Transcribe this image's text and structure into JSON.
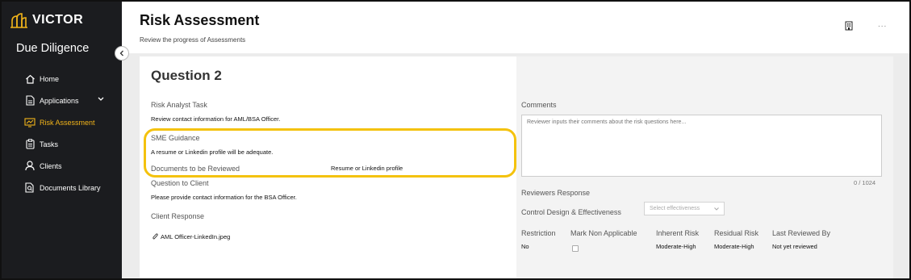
{
  "brand": {
    "name": "VICTOR",
    "accent": "#f2b41a"
  },
  "sidebar": {
    "app_title": "Due Diligence",
    "items": [
      {
        "label": "Home",
        "icon": "home-icon"
      },
      {
        "label": "Applications",
        "icon": "document-icon"
      },
      {
        "label": "Risk Assessment",
        "icon": "monitor-chart-icon",
        "active": true
      },
      {
        "label": "Tasks",
        "icon": "clipboard-icon"
      },
      {
        "label": "Clients",
        "icon": "user-icon"
      },
      {
        "label": "Documents Library",
        "icon": "document-search-icon"
      }
    ]
  },
  "header": {
    "title": "Risk Assessment",
    "subtitle": "Review the progress of Assessments",
    "more": "..."
  },
  "question": {
    "title": "Question 2",
    "risk_task_label": "Risk Analyst Task",
    "risk_task_text": "Review contact information for AML/BSA Officer.",
    "sme_label": "SME Guidance",
    "sme_text": "A resume or Linkedin profile will be adequate.",
    "docs_label": "Documents to be Reviewed",
    "docs_value": "Resume or Linkedin profile",
    "client_q_label": "Question to Client",
    "client_q_text": "Please provide contact information for the BSA Officer.",
    "client_resp_label": "Client Response",
    "attachment": "AML Officer-LinkedIn.jpeg"
  },
  "review": {
    "comments_label": "Comments",
    "comments_placeholder": "Reviewer inputs their comments about the risk questions here...",
    "char_count": "0 / 1024",
    "reviewers_response_label": "Reviewers Response",
    "control_label": "Control Design & Effectiveness",
    "select_placeholder": "Select effectiveness",
    "restriction_label": "Restriction",
    "restriction_value": "No",
    "mark_na_label": "Mark Non Applicable",
    "inherent_label": "Inherent Risk",
    "inherent_value": "Moderate-High",
    "residual_label": "Residual Risk",
    "residual_value": "Moderate-High",
    "last_reviewed_label": "Last Reviewed By",
    "last_reviewed_value": "Not yet reviewed"
  }
}
